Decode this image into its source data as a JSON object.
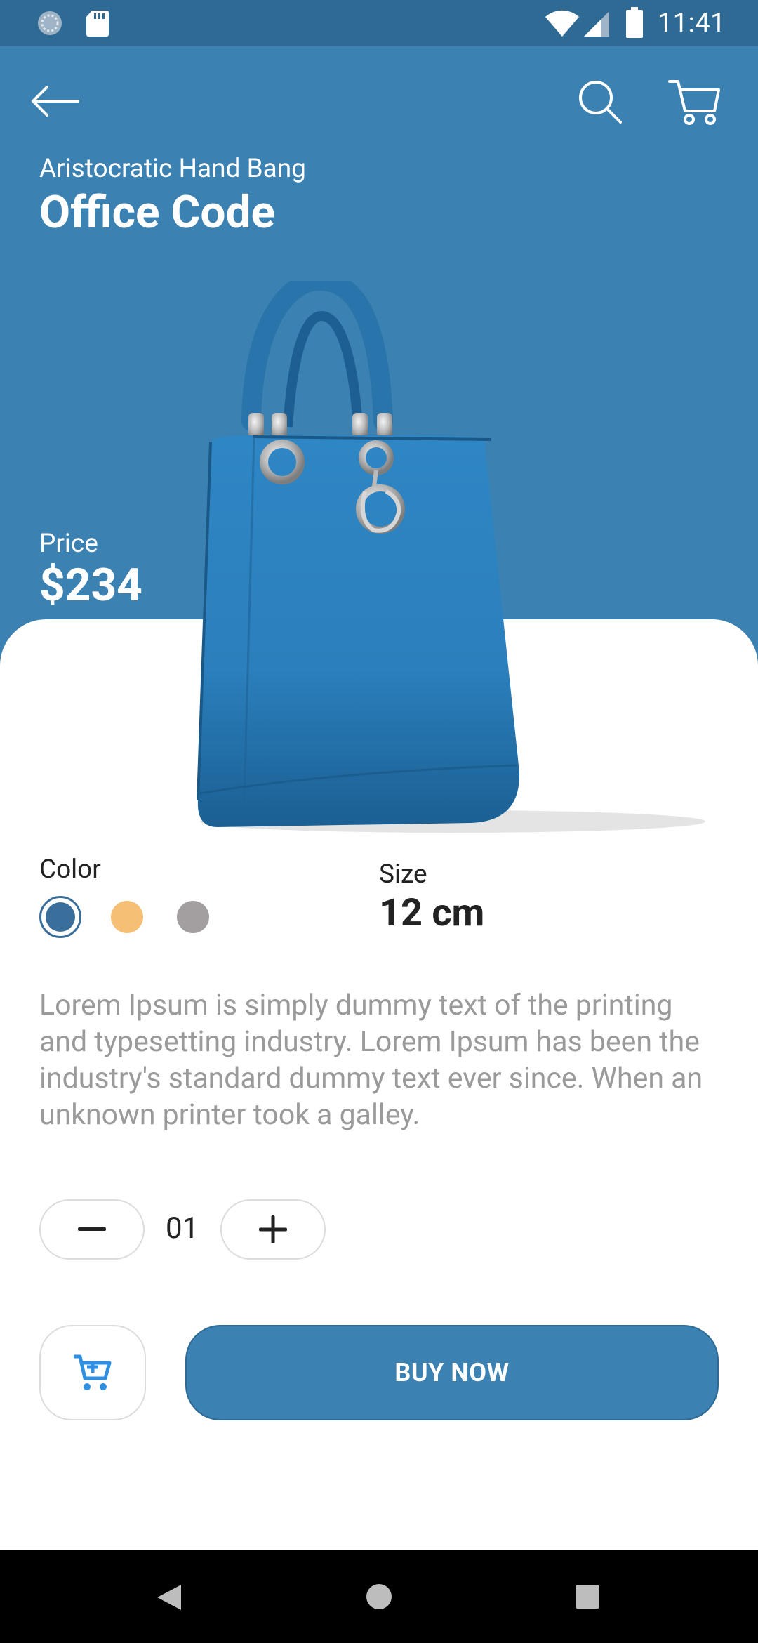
{
  "status_bar": {
    "time": "11:41"
  },
  "header": {
    "back_icon": "arrow-left-icon",
    "search_icon": "search-icon",
    "cart_icon": "shopping-cart-icon"
  },
  "product": {
    "subtitle": "Aristocratic Hand Bang",
    "title": "Office Code",
    "price_label": "Price",
    "price": "$234",
    "image": "blue-handbag"
  },
  "options": {
    "color_label": "Color",
    "colors": [
      "#3b6f9b",
      "#f6bf76",
      "#a39e9f"
    ],
    "selected_color_index": 0,
    "size_label": "Size",
    "size_value": "12 cm"
  },
  "description": "Lorem Ipsum is simply dummy text of the printing and typesetting industry. Lorem Ipsum has been the industry's standard dummy text ever since. When an unknown printer took a galley.",
  "quantity": {
    "value": "01"
  },
  "actions": {
    "buy_label": "BUY NOW"
  },
  "theme": {
    "accent": "#3b82b3",
    "status_bar": "#2f6a94"
  }
}
